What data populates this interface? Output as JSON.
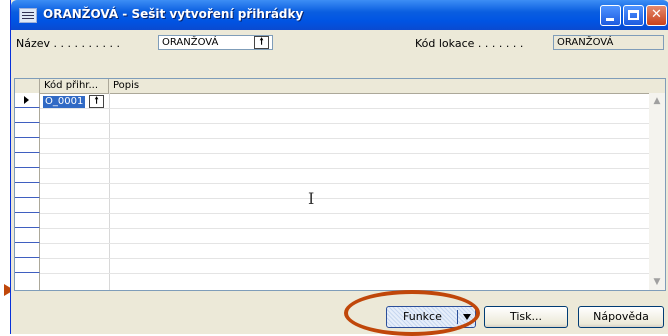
{
  "window": {
    "title": "ORANŽOVÁ - Sešit vytvoření přihrádky",
    "controls": [
      "minimize-icon",
      "maximize-icon",
      "close-icon"
    ]
  },
  "form": {
    "name_label": "Název . . . . . . . . . .",
    "name_value": "ORANŽOVÁ",
    "lookup_glyph": "🠕",
    "location_label": "Kód lokace . . . . . . .",
    "location_value": "ORANŽOVÁ"
  },
  "grid": {
    "columns": [
      "Kód přihr...",
      "Popis"
    ],
    "rows": [
      {
        "code": "O_0001",
        "description": ""
      }
    ],
    "row_count": 12
  },
  "buttons": {
    "funkce": "Funkce",
    "tisk": "Tisk...",
    "napoveda": "Nápověda"
  },
  "colors": {
    "titlebar": "#0054e3",
    "highlight": "#c0470a",
    "selection": "#316ac5"
  }
}
